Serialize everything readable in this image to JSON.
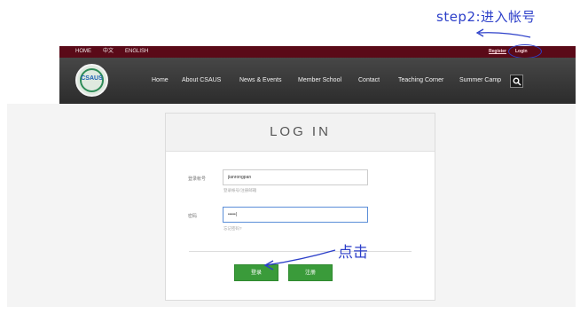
{
  "annotations": {
    "step_note": "step2:进入帐号",
    "click_note": "点击"
  },
  "topbar": {
    "links": [
      "HOME",
      "中文",
      "ENGLISH"
    ],
    "register": "Register",
    "login": "Login"
  },
  "logo": {
    "text": "CSAUS"
  },
  "nav": {
    "items": [
      "Home",
      "About CSAUS",
      "News & Events",
      "Member School",
      "Contact",
      "Teaching Corner",
      "Summer Camp"
    ],
    "search_icon": "search-icon"
  },
  "login_card": {
    "title": "LOG IN",
    "account_label": "登录帐号",
    "account_value": "jianrongpan",
    "account_hint": "登录帐号/注册邮箱",
    "password_label": "密码",
    "password_value": "•••••|",
    "password_hint": "忘记密码?",
    "login_button": "登录",
    "register_button": "注册"
  },
  "colors": {
    "topbar": "#5a0a18",
    "nav": "#333333",
    "button_green": "#3a9b3a",
    "annotation_ink": "#2c3fc9"
  }
}
